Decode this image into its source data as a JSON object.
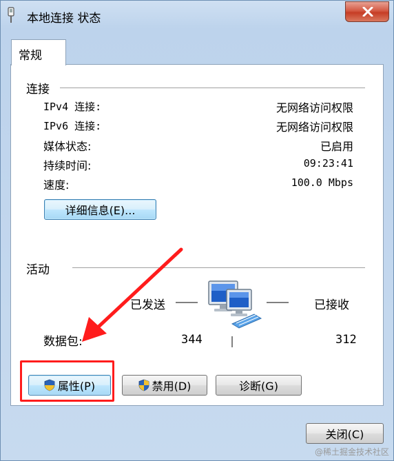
{
  "window": {
    "title": "本地连接 状态",
    "title_icon": "network-adapter-icon",
    "close_icon": "close-x-icon"
  },
  "tabs": [
    {
      "label": "常规",
      "selected": true
    }
  ],
  "connection": {
    "heading": "连接",
    "rows": [
      {
        "label": "IPv4 连接:",
        "value": "无网络访问权限"
      },
      {
        "label": "IPv6 连接:",
        "value": "无网络访问权限"
      },
      {
        "label": "媒体状态:",
        "value": "已启用"
      },
      {
        "label": "持续时间:",
        "value": "09:23:41"
      },
      {
        "label": "速度:",
        "value": "100.0 Mbps"
      }
    ],
    "details_button": "详细信息(E)..."
  },
  "activity": {
    "heading": "活动",
    "sent_label": "已发送",
    "received_label": "已接收",
    "packets_label": "数据包:",
    "packets_sent": "344",
    "packets_received": "312",
    "icon": "network-computers-icon"
  },
  "buttons": {
    "properties": "属性(P)",
    "disable": "禁用(D)",
    "diagnose": "诊断(G)",
    "close": "关闭(C)"
  },
  "annotation": {
    "arrow_color": "#ff1c1c",
    "highlight_color": "#ff1c1c"
  },
  "watermark": "@稀土掘金技术社区"
}
